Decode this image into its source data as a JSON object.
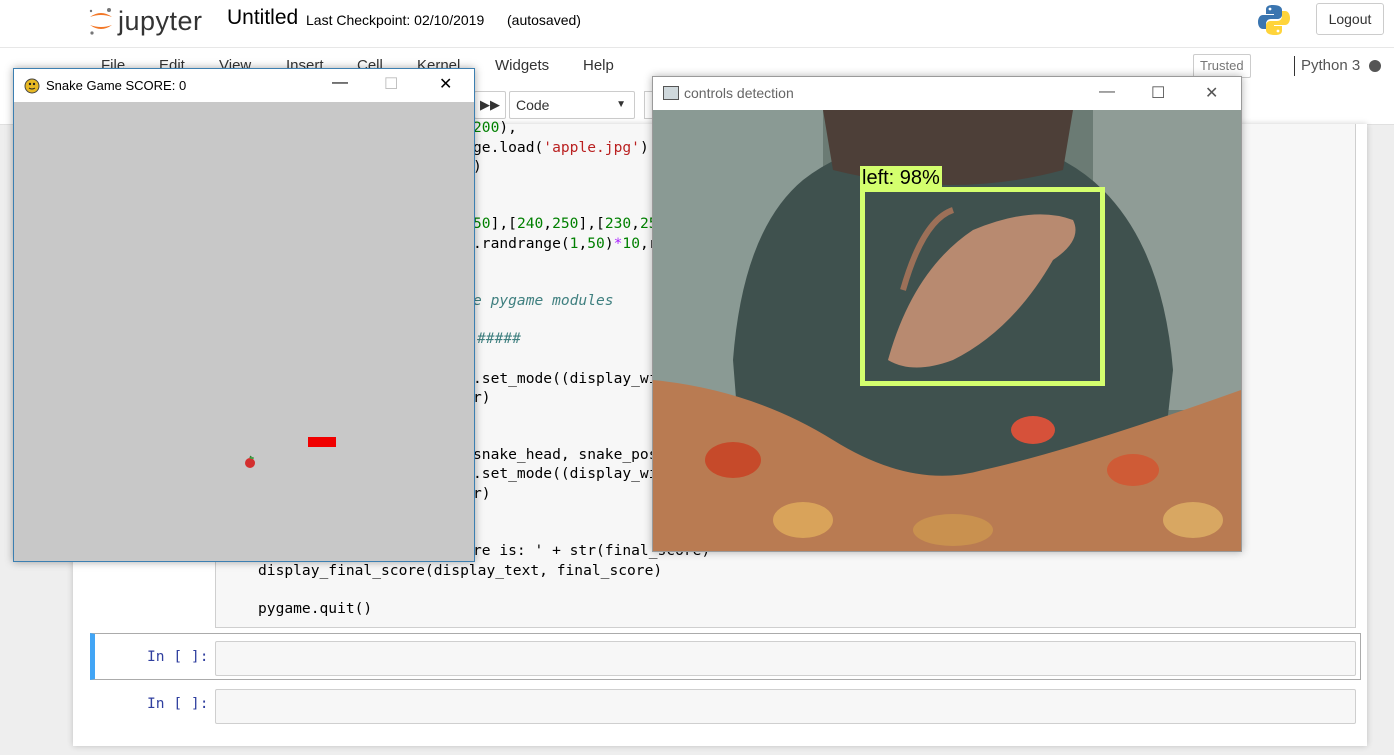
{
  "header": {
    "logo_text": "jupyter",
    "notebook_name": "Untitled",
    "checkpoint": "Last Checkpoint: 02/10/2019",
    "autosave": "(autosaved)",
    "logout_label": "Logout"
  },
  "menubar": {
    "items": [
      "File",
      "Edit",
      "View",
      "Insert",
      "Cell",
      "Kernel",
      "Widgets",
      "Help"
    ],
    "trusted": "Trusted",
    "kernel_name": "Python 3"
  },
  "toolbar": {
    "cell_type": "Code"
  },
  "code_cell": {
    "lines": [
      {
        "parts": [
          [
            "num",
            "200"
          ],
          [
            "",
            "),"
          ]
        ]
      },
      {
        "parts": [
          [
            "",
            "ge.load("
          ],
          [
            "str",
            "'apple.jpg'"
          ],
          [
            "",
            ")"
          ]
        ]
      },
      {
        "parts": [
          [
            "",
            ")"
          ]
        ]
      },
      {
        "parts": [
          [
            "num",
            "50"
          ],
          [
            "",
            "],["
          ],
          [
            "num",
            "240"
          ],
          [
            "",
            ","
          ],
          [
            "num",
            "250"
          ],
          [
            "",
            "],["
          ],
          [
            "num",
            "230"
          ],
          [
            "",
            ","
          ],
          [
            "num",
            "25"
          ]
        ]
      },
      {
        "parts": [
          [
            "",
            ".randrange("
          ],
          [
            "num",
            "1"
          ],
          [
            "",
            ","
          ],
          [
            "num",
            "50"
          ],
          [
            "",
            ")"
          ],
          [
            "op",
            "*"
          ],
          [
            "num",
            "10"
          ],
          [
            "",
            ",r"
          ]
        ]
      },
      {
        "parts": [
          [
            "cm",
            "e pygame modules"
          ]
        ]
      },
      {
        "parts": [
          [
            "cm",
            "#####"
          ]
        ]
      },
      {
        "parts": [
          [
            "",
            ".set_mode((display_wi"
          ]
        ]
      },
      {
        "parts": [
          [
            "",
            "r)"
          ]
        ]
      },
      {
        "parts": [
          [
            "",
            "snake_head, snake_pos"
          ]
        ]
      },
      {
        "parts": [
          [
            "",
            ".set_mode((display_wi"
          ]
        ]
      },
      {
        "parts": [
          [
            "",
            "r)"
          ]
        ]
      },
      {
        "parts": [
          [
            "",
            "re is: "
          ],
          [
            "op",
            "+"
          ],
          [
            "",
            ""
          ]
        ]
      },
      {
        "parts": [
          [
            "",
            "display_final_score(display_text, final_score)"
          ]
        ]
      },
      {
        "parts": [
          [
            "",
            "pygame.quit()"
          ]
        ]
      }
    ],
    "tail_line_12": "re is: ' + str(final_score)"
  },
  "empty_cells": [
    {
      "prompt": "In [ ]:"
    },
    {
      "prompt": "In [ ]:"
    }
  ],
  "snake_window": {
    "title": "Snake Game  SCORE: 0",
    "minimize": "—",
    "maximize": "☐",
    "close": "✕"
  },
  "camera_window": {
    "title": "controls detection",
    "minimize": "—",
    "maximize": "☐",
    "close": "✕",
    "detection_label": "left: 98%"
  },
  "colors": {
    "accent": "#42a5f5",
    "detection_box": "#d4ff6e",
    "snake": "#f00000",
    "game_bg": "#c8c8c8"
  }
}
